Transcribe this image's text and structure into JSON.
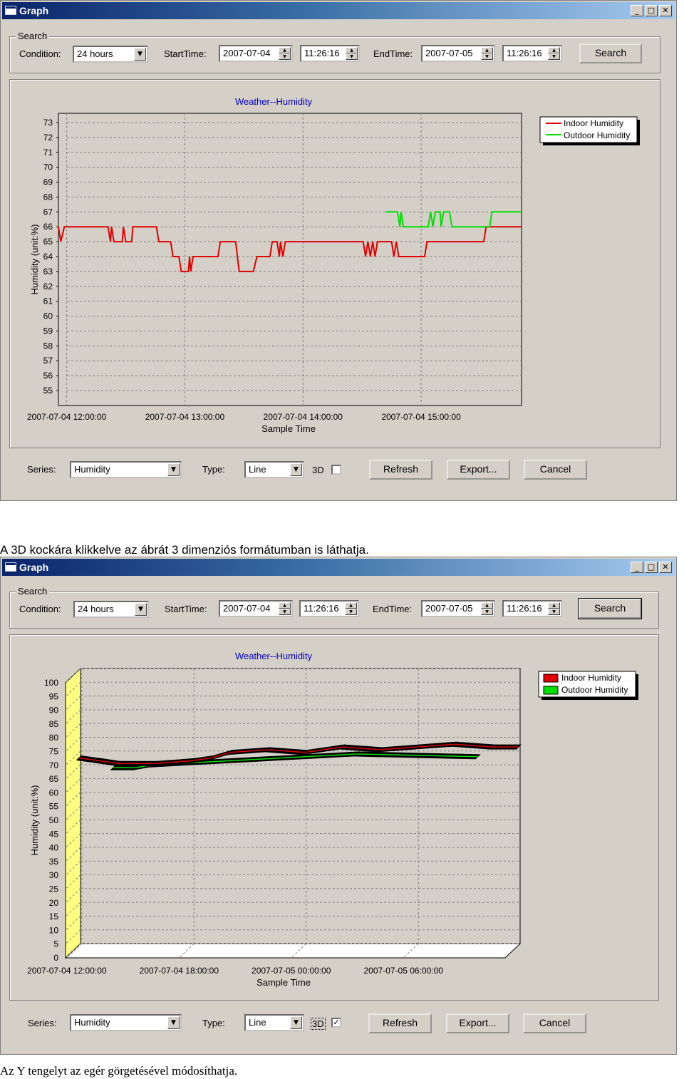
{
  "window_title": "Graph",
  "window_controls": {
    "minimize": "_",
    "maximize": "□",
    "close": "✕"
  },
  "search_group": {
    "title": "Search",
    "condition_label": "Condition:",
    "condition_value": "24 hours",
    "start_label": "StartTime:",
    "start_date": "2007-07-04",
    "start_time": "11:26:16",
    "end_label": "EndTime:",
    "end_date": "2007-07-05",
    "end_time": "11:26:16",
    "search_button": "Search"
  },
  "bottom_bar": {
    "series_label": "Series:",
    "series_value": "Humidity",
    "type_label": "Type:",
    "type_value": "Line",
    "threed_label": "3D",
    "refresh_button": "Refresh",
    "export_button": "Export...",
    "cancel_button": "Cancel"
  },
  "caption_middle": "A 3D kockára klikkelve az ábrát 3 dimenziós formátumban is láthatja.",
  "caption_bottom": "Az Y tengelyt az egér görgetésével módosíthatja.",
  "colors": {
    "indoor": "#e00000",
    "outdoor": "#00e000",
    "title": "#0000c0",
    "wall": "#ffff80"
  },
  "screens": [
    {
      "threed_checked": false,
      "chart_data": {
        "type": "line",
        "title": "Weather--Humidity",
        "xlabel": "Sample Time",
        "ylabel": "Humidity (unit:%)",
        "ylim": [
          55,
          73
        ],
        "y_ticks": [
          "73",
          "72",
          "71",
          "70",
          "69",
          "68",
          "67",
          "66",
          "65",
          "64",
          "63",
          "62",
          "61",
          "60",
          "59",
          "58",
          "57",
          "56",
          "55"
        ],
        "x_ticks": [
          "2007-07-04 12:00:00",
          "2007-07-04 13:00:00",
          "2007-07-04 14:00:00",
          "2007-07-04 15:00:00"
        ],
        "x_tick_hours": [
          12,
          13,
          14,
          15
        ],
        "xlim_hours": [
          11.93,
          15.85
        ],
        "grid": true,
        "legend_position": "top-right",
        "series": [
          {
            "name": "Indoor Humidity",
            "color": "#e00000",
            "points": [
              [
                11.93,
                66
              ],
              [
                11.95,
                65
              ],
              [
                11.98,
                66
              ],
              [
                12.35,
                66
              ],
              [
                12.37,
                65
              ],
              [
                12.38,
                66
              ],
              [
                12.4,
                65
              ],
              [
                12.47,
                65
              ],
              [
                12.48,
                66
              ],
              [
                12.5,
                65
              ],
              [
                12.55,
                65
              ],
              [
                12.56,
                66
              ],
              [
                12.76,
                66
              ],
              [
                12.78,
                65
              ],
              [
                12.88,
                65
              ],
              [
                12.9,
                64
              ],
              [
                12.95,
                64
              ],
              [
                12.97,
                63
              ],
              [
                13.03,
                63
              ],
              [
                13.04,
                64
              ],
              [
                13.05,
                63
              ],
              [
                13.07,
                64
              ],
              [
                13.28,
                64
              ],
              [
                13.3,
                65
              ],
              [
                13.43,
                65
              ],
              [
                13.46,
                63
              ],
              [
                13.58,
                63
              ],
              [
                13.61,
                64
              ],
              [
                13.72,
                64
              ],
              [
                13.74,
                65
              ],
              [
                13.78,
                65
              ],
              [
                13.8,
                64
              ],
              [
                13.81,
                65
              ],
              [
                13.83,
                64
              ],
              [
                13.85,
                65
              ],
              [
                14.51,
                65
              ],
              [
                14.53,
                64
              ],
              [
                14.55,
                65
              ],
              [
                14.57,
                64
              ],
              [
                14.59,
                65
              ],
              [
                14.61,
                64
              ],
              [
                14.63,
                65
              ],
              [
                14.75,
                65
              ],
              [
                14.77,
                64
              ],
              [
                14.79,
                65
              ],
              [
                14.81,
                64
              ],
              [
                15.03,
                64
              ],
              [
                15.05,
                65
              ],
              [
                15.53,
                65
              ],
              [
                15.55,
                66
              ],
              [
                15.85,
                66
              ]
            ]
          },
          {
            "name": "Outdoor Humidity",
            "color": "#00e000",
            "points": [
              [
                14.7,
                67
              ],
              [
                14.8,
                67
              ],
              [
                14.82,
                66
              ],
              [
                14.83,
                67
              ],
              [
                14.85,
                66
              ],
              [
                15.06,
                66
              ],
              [
                15.08,
                67
              ],
              [
                15.1,
                66
              ],
              [
                15.12,
                67
              ],
              [
                15.16,
                67
              ],
              [
                15.17,
                66
              ],
              [
                15.19,
                67
              ],
              [
                15.24,
                67
              ],
              [
                15.26,
                66
              ],
              [
                15.58,
                66
              ],
              [
                15.6,
                67
              ],
              [
                15.85,
                67
              ]
            ]
          }
        ]
      }
    },
    {
      "threed_checked": true,
      "chart_data": {
        "type": "line",
        "title": "Weather--Humidity",
        "xlabel": "Sample Time",
        "ylabel": "Humidity (unit:%)",
        "ylim": [
          0,
          100
        ],
        "y_ticks": [
          "100",
          "95",
          "90",
          "85",
          "80",
          "75",
          "70",
          "65",
          "60",
          "55",
          "50",
          "45",
          "40",
          "35",
          "30",
          "25",
          "20",
          "15",
          "10",
          "5",
          "0"
        ],
        "x_ticks": [
          "2007-07-04 12:00:00",
          "2007-07-04 18:00:00",
          "2007-07-05 00:00:00",
          "2007-07-05 06:00:00"
        ],
        "x_tick_hours": [
          12,
          18,
          24,
          30
        ],
        "xlim_hours": [
          11.93,
          35.44
        ],
        "grid": true,
        "three_d": true,
        "legend_position": "top-right",
        "series": [
          {
            "name": "Indoor Humidity",
            "color": "#e00000",
            "points": [
              [
                11.93,
                68
              ],
              [
                13.0,
                67
              ],
              [
                14.0,
                66
              ],
              [
                16.0,
                66
              ],
              [
                18.0,
                67
              ],
              [
                19.0,
                68
              ],
              [
                20.0,
                70
              ],
              [
                22.0,
                71
              ],
              [
                24.0,
                70
              ],
              [
                26.0,
                72
              ],
              [
                28.0,
                71
              ],
              [
                30.0,
                72
              ],
              [
                32.0,
                73
              ],
              [
                34.0,
                72
              ],
              [
                35.44,
                72
              ]
            ]
          },
          {
            "name": "Outdoor Humidity",
            "color": "#00e000",
            "points": [
              [
                14.0,
                66
              ],
              [
                15.2,
                66
              ],
              [
                16.0,
                67
              ],
              [
                27.0,
                71
              ],
              [
                33.5,
                70
              ]
            ]
          }
        ]
      }
    }
  ]
}
